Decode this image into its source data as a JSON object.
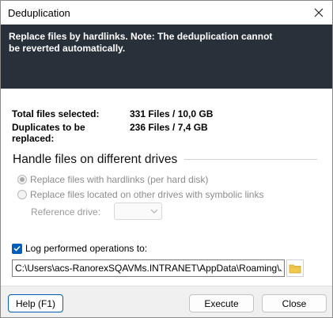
{
  "window": {
    "title": "Deduplication"
  },
  "banner": {
    "text": "Replace files by hardlinks. Note: The deduplication cannot be reverted automatically."
  },
  "summary": {
    "total_label": "Total files selected:",
    "total_value": "331 Files / 10,0 GB",
    "duplicates_label": "Duplicates to be replaced:",
    "duplicates_value": "236 Files / 7,4 GB"
  },
  "drives_section": {
    "heading": "Handle files on different drives",
    "options": [
      {
        "label": "Replace files with hardlinks (per hard disk)",
        "selected": true,
        "enabled": false
      },
      {
        "label": "Replace files located on other drives with symbolic links",
        "selected": false,
        "enabled": false
      }
    ],
    "reference_drive_label": "Reference drive:",
    "reference_drive_value": ""
  },
  "log": {
    "label": "Log performed operations to:",
    "checked": true,
    "path": "C:\\Users\\acs-RanorexSQAVMs.INTRANET\\AppData\\Roaming\\JAM"
  },
  "buttons": {
    "help": "Help (F1)",
    "execute": "Execute",
    "close": "Close"
  },
  "icons": {
    "close": "close-icon",
    "folder": "folder-icon",
    "check": "checkmark-icon",
    "dropdown": "chevron-down-icon"
  },
  "colors": {
    "banner_bg": "#28313a",
    "accent": "#005fb8",
    "folder": "#f2c94c"
  }
}
